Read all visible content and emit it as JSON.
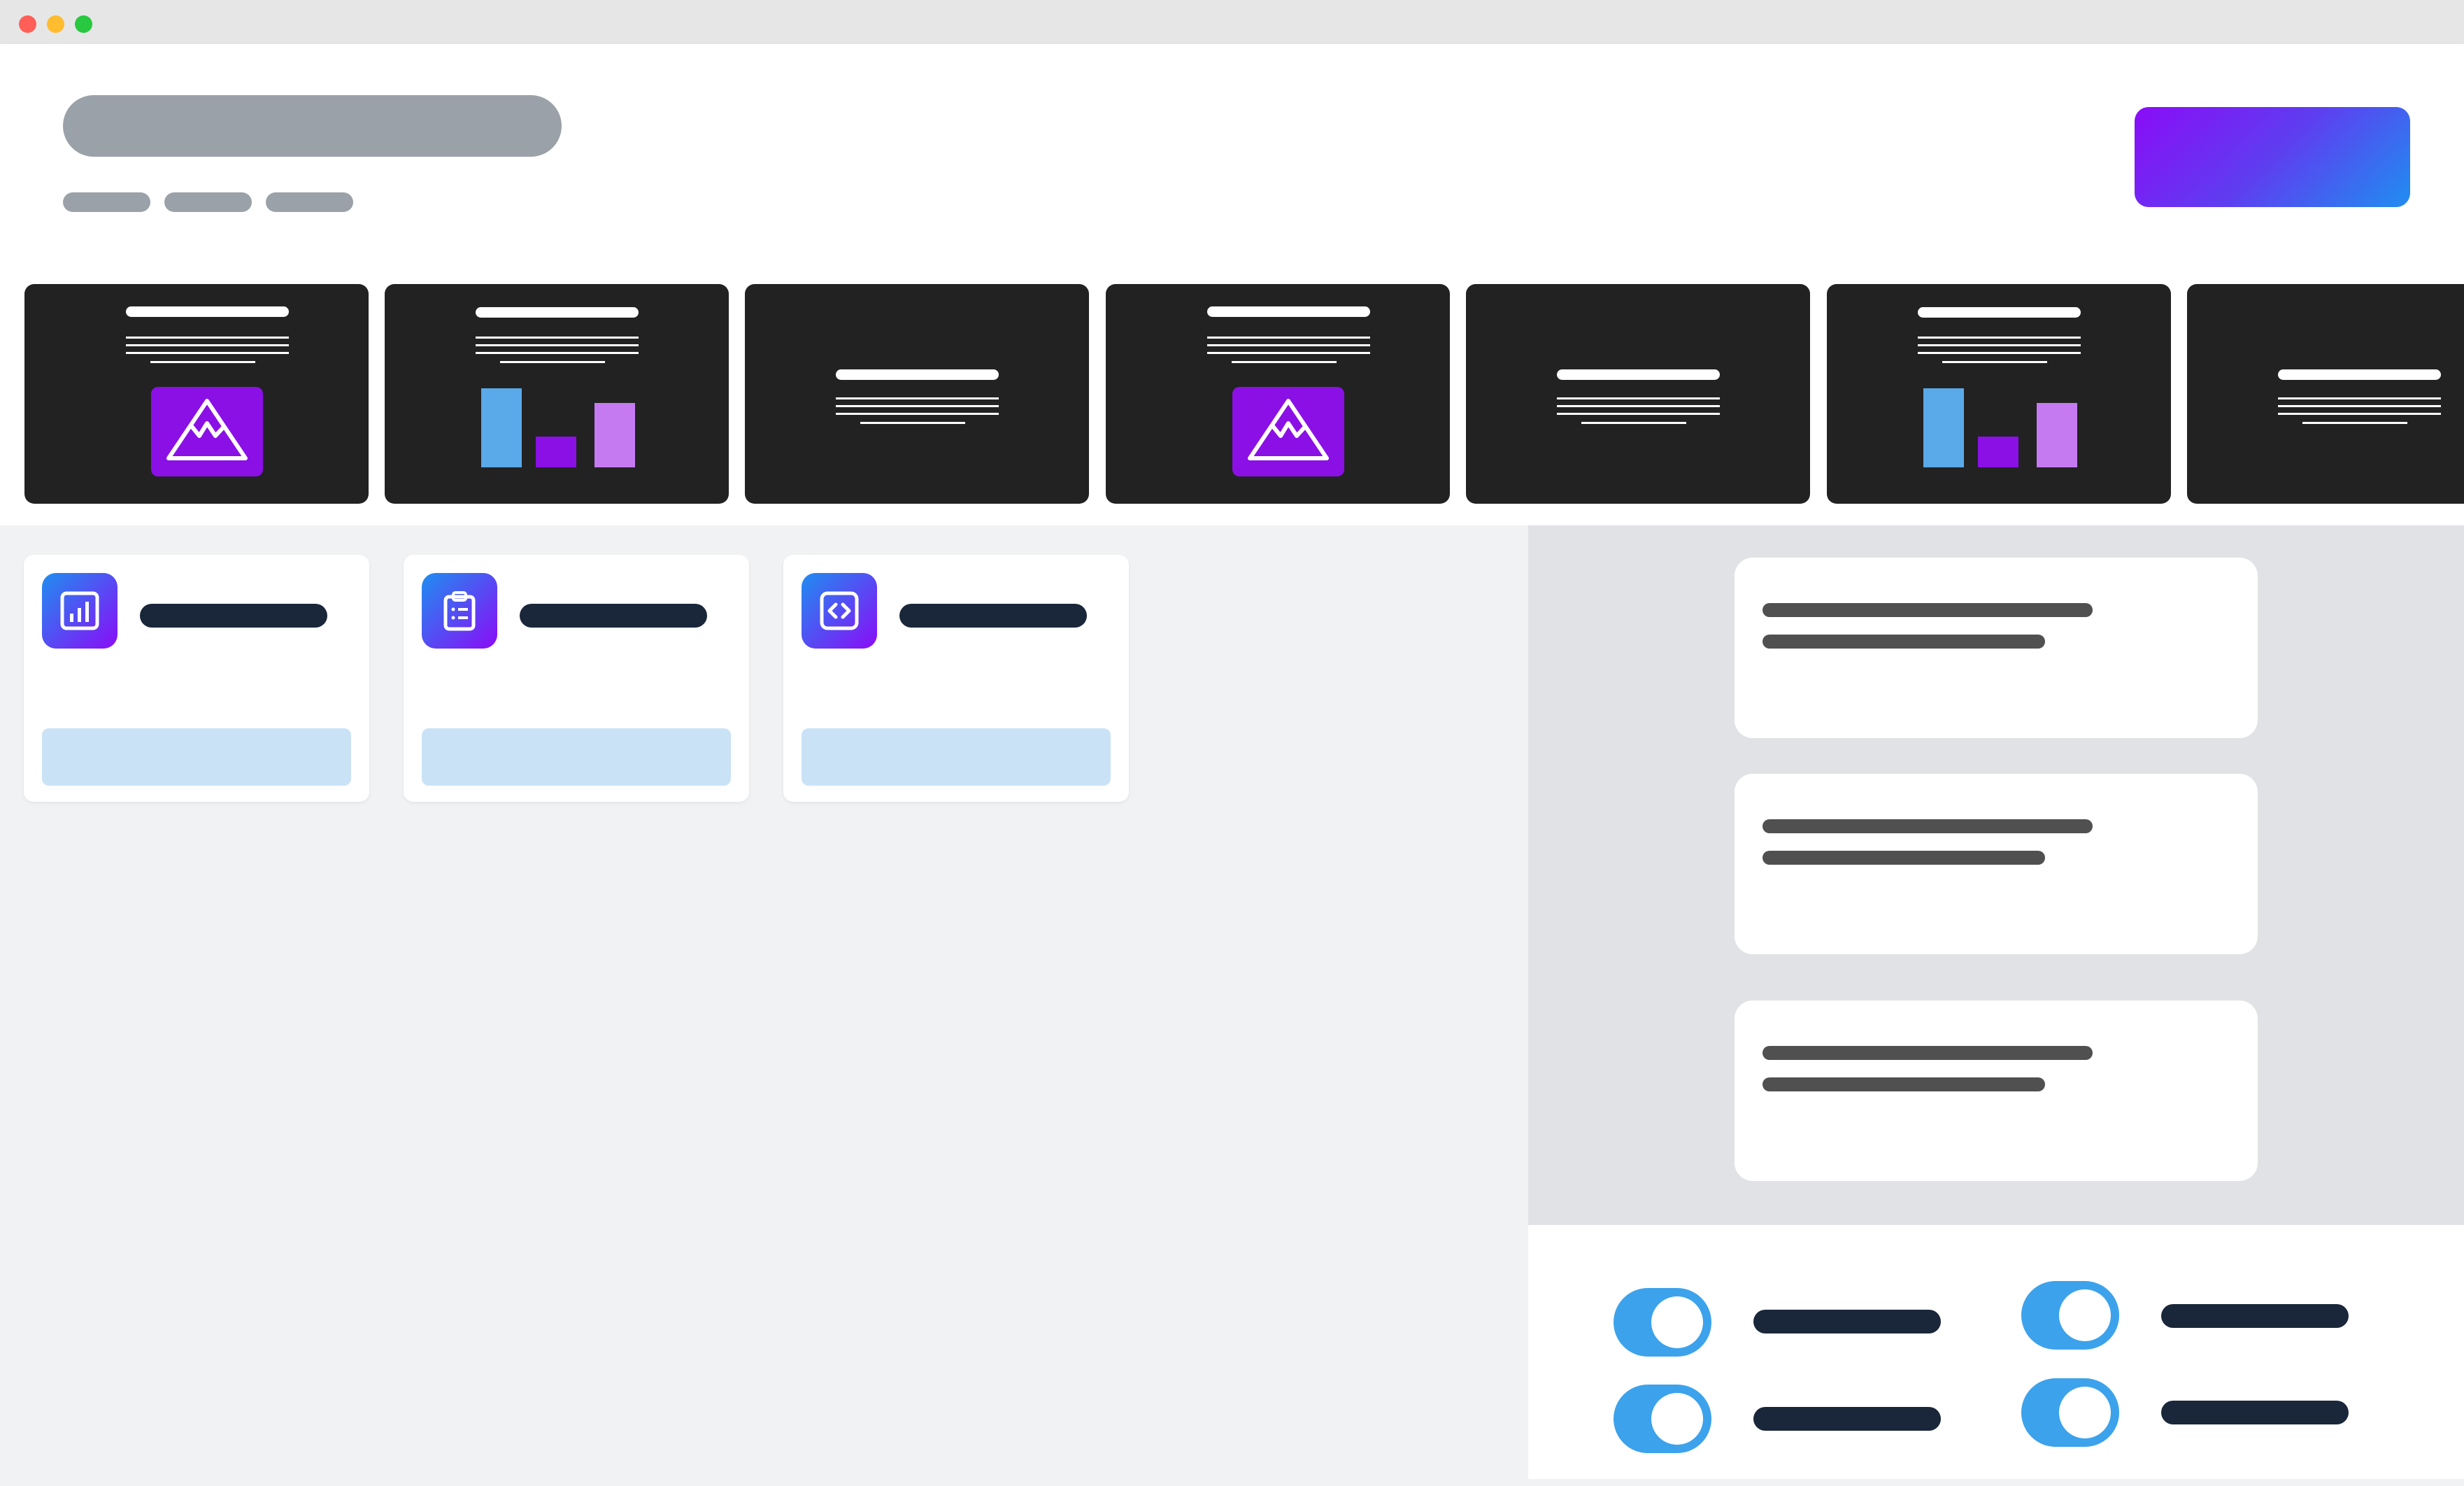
{
  "window": {
    "controls": [
      "close-dot",
      "minimize-dot",
      "maximize-dot"
    ],
    "colors": {
      "close": "#ff5f57",
      "minimize": "#febc2e",
      "maximize": "#28c840"
    }
  },
  "header": {
    "title": "",
    "breadcrumbs": [
      "",
      "",
      ""
    ],
    "primary_action_label": ""
  },
  "slides": [
    {
      "type": "text-image",
      "icon": "mountain-icon"
    },
    {
      "type": "text-chart",
      "icon": "bar-chart"
    },
    {
      "type": "text-only"
    },
    {
      "type": "text-image",
      "icon": "mountain-icon"
    },
    {
      "type": "text-only"
    },
    {
      "type": "text-chart",
      "icon": "bar-chart"
    },
    {
      "type": "text-only"
    }
  ],
  "tools": [
    {
      "title": "",
      "icon": "bar-chart-icon",
      "action_label": ""
    },
    {
      "title": "",
      "icon": "clipboard-icon",
      "action_label": ""
    },
    {
      "title": "",
      "icon": "code-icon",
      "action_label": ""
    }
  ],
  "notes": [
    {
      "line1": "",
      "line2": ""
    },
    {
      "line1": "",
      "line2": ""
    },
    {
      "line1": "",
      "line2": ""
    }
  ],
  "settings": [
    {
      "label": "",
      "enabled": true
    },
    {
      "label": "",
      "enabled": true
    },
    {
      "label": "",
      "enabled": true
    },
    {
      "label": "",
      "enabled": true
    }
  ],
  "colors": {
    "accent_gradient": [
      "#8a0cf7",
      "#1f8ef0"
    ],
    "slide_background": "#222222",
    "image_placeholder": "#8a10e6",
    "chart_bars": [
      "#5aa9e8",
      "#8a10e6",
      "#c57af2"
    ],
    "toggle_on": "#3ca2eb"
  }
}
